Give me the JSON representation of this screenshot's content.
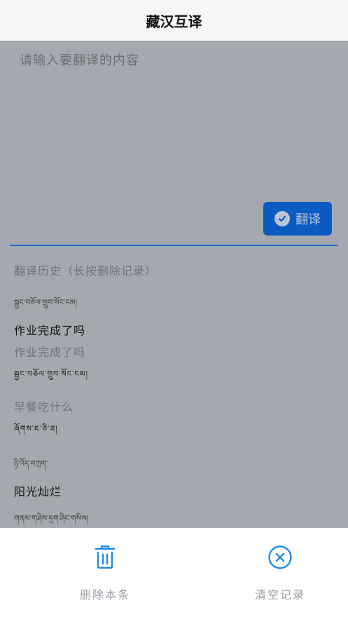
{
  "header": {
    "title": "藏汉互译"
  },
  "input": {
    "placeholder": "请输入要翻译的内容"
  },
  "translate_button": {
    "label": "翻译",
    "icon": "check-circle-icon"
  },
  "history": {
    "title": "翻译历史（长按删除记录）",
    "entries": [
      {
        "source": "སྦྱང་བཅོལ་གྲུབ་སོང་ངམ།",
        "target": "作业完成了吗",
        "source_is_tibetan": true
      },
      {
        "source": "作业完成了吗",
        "target": "སྦྱང་བཅོལ་གྲུབ་སོང་ངམ།",
        "source_is_tibetan": false
      },
      {
        "source": "早餐吃什么",
        "target": "ཞོགས་ཇ་ཅི་ཟ།",
        "source_is_tibetan": false
      },
      {
        "source": "ཉི་འོད་བཀྲག་",
        "target": "阳光灿烂",
        "source_is_tibetan": true
      },
      {
        "source": "གནམ་གཤིས་དྲག་ཤིང་གསིལ།",
        "target": "",
        "source_is_tibetan": true
      }
    ]
  },
  "footer": {
    "delete_label": "删除本条",
    "clear_label": "清空记录",
    "delete_icon": "trash-icon",
    "clear_icon": "close-circle-icon"
  },
  "colors": {
    "accent": "#0a5cc2",
    "icon": "#1f8ae8",
    "overlay": "#a5a9af"
  }
}
